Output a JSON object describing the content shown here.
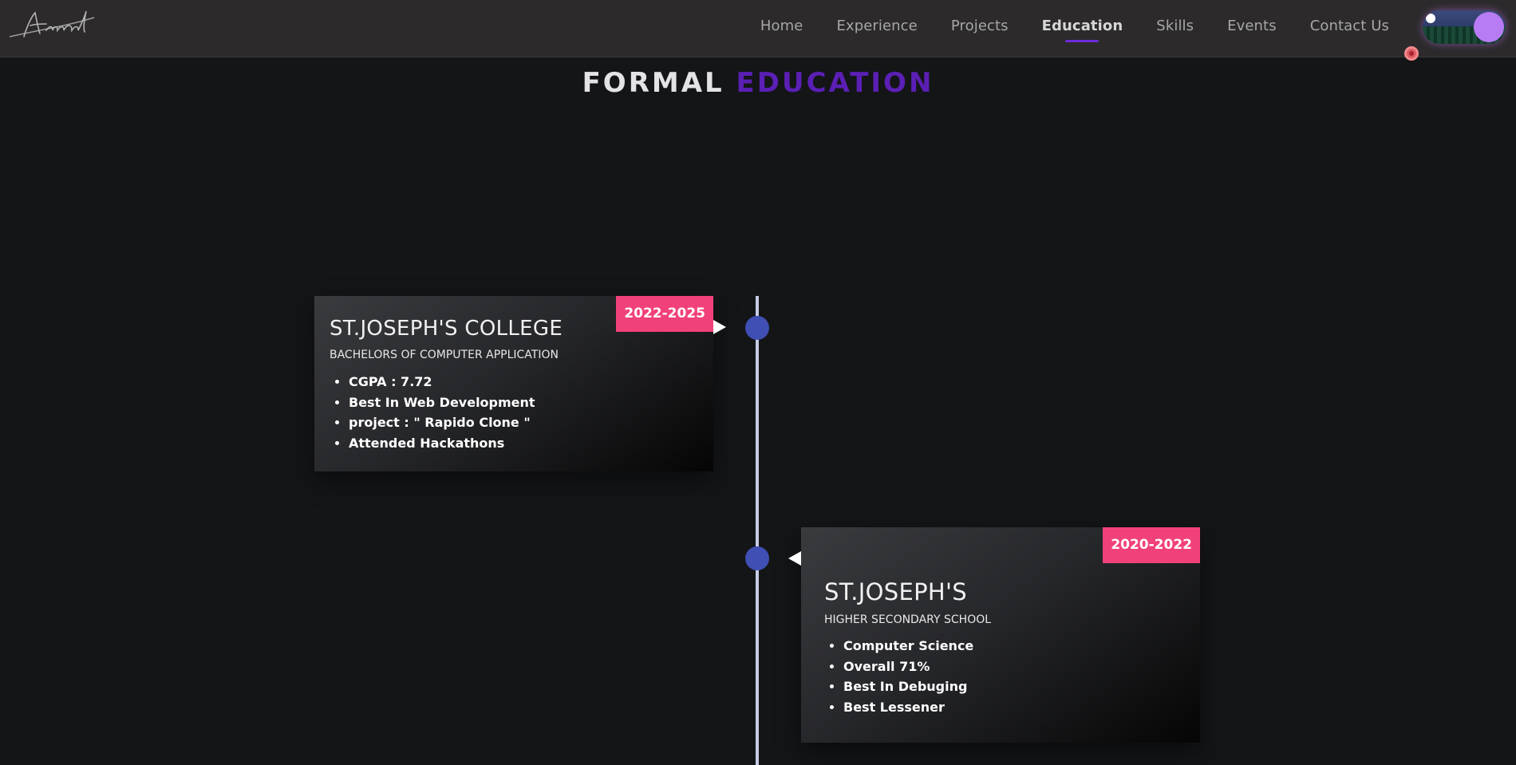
{
  "nav": {
    "logo_text": "Anand",
    "links": [
      {
        "label": "Home"
      },
      {
        "label": "Experience"
      },
      {
        "label": "Projects"
      },
      {
        "label": "Education"
      },
      {
        "label": "Skills"
      },
      {
        "label": "Events"
      },
      {
        "label": "Contact Us"
      }
    ],
    "active": "Education"
  },
  "section": {
    "title_part1": "FORMAL",
    "title_part2": "EDUCATION"
  },
  "timeline": [
    {
      "year": "2022-2025",
      "institution": "ST.JOSEPH'S COLLEGE",
      "course": "BACHELORS OF COMPUTER APPLICATION",
      "highlights": [
        "CGPA : 7.72",
        "Best In Web Development",
        "project : \" Rapido Clone \"",
        "Attended Hackathons"
      ]
    },
    {
      "year": "2020-2022",
      "institution": "ST.JOSEPH'S",
      "course": "HIGHER SECONDARY SCHOOL",
      "highlights": [
        "Computer Science",
        "Overall 71%",
        "Best In Debuging",
        "Best Lessener"
      ]
    }
  ],
  "colors": {
    "background": "#141517",
    "navbar": "#2c2a2b",
    "accent_purple": "#5b1fb5",
    "badge_pink": "#f1417a",
    "timeline_dot": "#3f4fb3"
  }
}
